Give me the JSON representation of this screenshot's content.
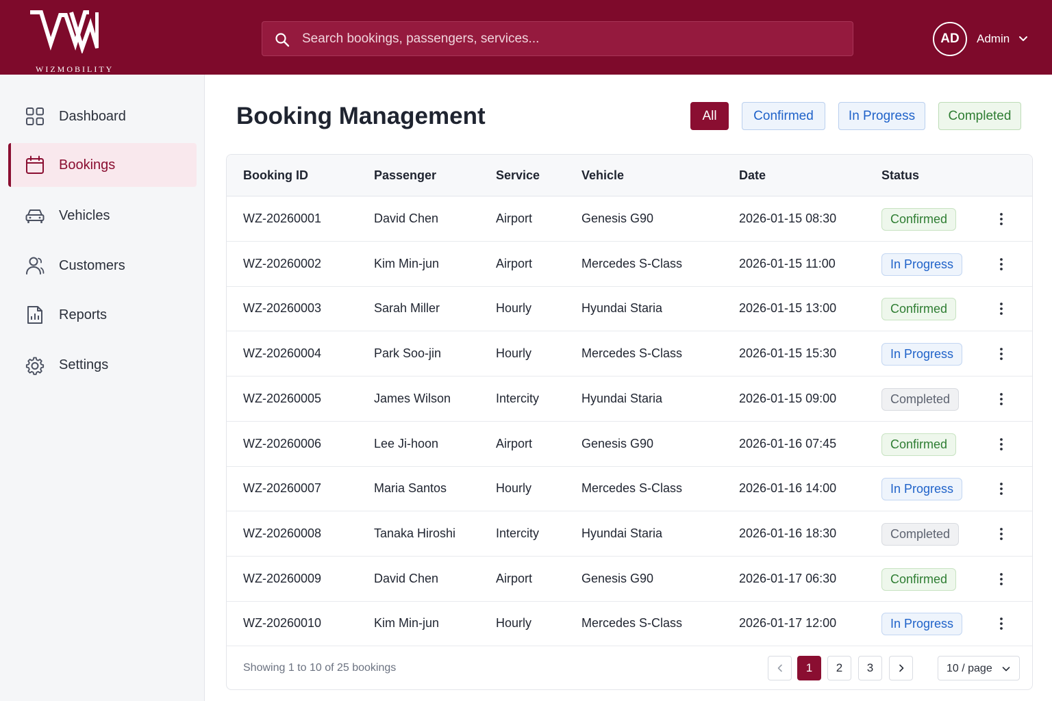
{
  "brand": {
    "name": "WIZMOBILITY",
    "accent": "#7e0a2b"
  },
  "search": {
    "placeholder": "Search bookings, passengers, services..."
  },
  "user": {
    "initials": "AD",
    "name": "Admin"
  },
  "sidebar": {
    "items": [
      {
        "label": "Dashboard",
        "icon": "dashboard-icon",
        "active": false
      },
      {
        "label": "Bookings",
        "icon": "calendar-icon",
        "active": true
      },
      {
        "label": "Vehicles",
        "icon": "car-icon",
        "active": false
      },
      {
        "label": "Customers",
        "icon": "user-icon",
        "active": false
      },
      {
        "label": "Reports",
        "icon": "report-icon",
        "active": false
      },
      {
        "label": "Settings",
        "icon": "gear-icon",
        "active": false
      }
    ]
  },
  "page": {
    "title": "Booking Management",
    "filters": [
      "All",
      "Confirmed",
      "In Progress",
      "Completed"
    ],
    "active_filter": "All"
  },
  "table": {
    "columns": [
      "Booking ID",
      "Passenger",
      "Service",
      "Vehicle",
      "Date",
      "Status"
    ],
    "rows": [
      {
        "id": "WZ-20260001",
        "passenger": "David Chen",
        "service": "Airport",
        "vehicle": "Genesis G90",
        "date": "2026-01-15 08:30",
        "status": "Confirmed"
      },
      {
        "id": "WZ-20260002",
        "passenger": "Kim Min-jun",
        "service": "Airport",
        "vehicle": "Mercedes S-Class",
        "date": "2026-01-15 11:00",
        "status": "In Progress"
      },
      {
        "id": "WZ-20260003",
        "passenger": "Sarah Miller",
        "service": "Hourly",
        "vehicle": "Hyundai Staria",
        "date": "2026-01-15 13:00",
        "status": "Confirmed"
      },
      {
        "id": "WZ-20260004",
        "passenger": "Park Soo-jin",
        "service": "Hourly",
        "vehicle": "Mercedes S-Class",
        "date": "2026-01-15 15:30",
        "status": "In Progress"
      },
      {
        "id": "WZ-20260005",
        "passenger": "James Wilson",
        "service": "Intercity",
        "vehicle": "Hyundai Staria",
        "date": "2026-01-15 09:00",
        "status": "Completed"
      },
      {
        "id": "WZ-20260006",
        "passenger": "Lee Ji-hoon",
        "service": "Airport",
        "vehicle": "Genesis G90",
        "date": "2026-01-16 07:45",
        "status": "Confirmed"
      },
      {
        "id": "WZ-20260007",
        "passenger": "Maria Santos",
        "service": "Hourly",
        "vehicle": "Mercedes S-Class",
        "date": "2026-01-16 14:00",
        "status": "In Progress"
      },
      {
        "id": "WZ-20260008",
        "passenger": "Tanaka Hiroshi",
        "service": "Intercity",
        "vehicle": "Hyundai Staria",
        "date": "2026-01-16 18:30",
        "status": "Completed"
      },
      {
        "id": "WZ-20260009",
        "passenger": "David Chen",
        "service": "Airport",
        "vehicle": "Genesis G90",
        "date": "2026-01-17 06:30",
        "status": "Confirmed"
      },
      {
        "id": "WZ-20260010",
        "passenger": "Kim Min-jun",
        "service": "Hourly",
        "vehicle": "Mercedes S-Class",
        "date": "2026-01-17 12:00",
        "status": "In Progress"
      }
    ]
  },
  "pagination": {
    "summary": "Showing 1 to 10 of 25 bookings",
    "pages": [
      "1",
      "2",
      "3"
    ],
    "current": "1",
    "per_page": "10 / page"
  }
}
